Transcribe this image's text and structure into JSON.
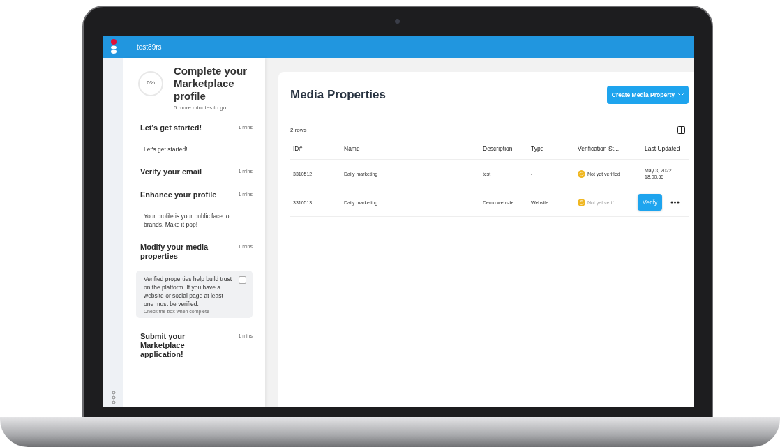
{
  "top_bar": {
    "title": "test89rs"
  },
  "onboarding": {
    "progress": {
      "label": "0%",
      "level": 0
    },
    "title": "Complete your Marketplace profile",
    "subtitle": "5 more minutes to go!",
    "steps": [
      {
        "kind": "text",
        "title": "Let's get started!",
        "duration": "1 mins",
        "description": "Let's get started!"
      },
      {
        "kind": "none",
        "title": "Verify your email",
        "duration": "1 mins"
      },
      {
        "kind": "text",
        "title": "Enhance your profile",
        "duration": "1 mins",
        "description": "Your profile is your public face to brands. Make it pop!"
      },
      {
        "kind": "checkbox",
        "title": "Modify your media properties",
        "duration": "1 mins",
        "description": "Verified properties help build trust on the platform. If you have a website or social page at least one must be verified.",
        "hint": "Check the box when complete",
        "checked": false
      },
      {
        "kind": "none",
        "title": "Submit your Marketplace application!",
        "duration": "1 mins"
      }
    ]
  },
  "main": {
    "title": "Media Properties",
    "create_button": "Create Media Property",
    "row_count": "2 rows",
    "table": {
      "columns": [
        "ID#",
        "Name",
        "Description",
        "Type",
        "Verification St...",
        "Last Updated"
      ],
      "rows": [
        {
          "id": "3310512",
          "name": "Daily marketing",
          "description": "test",
          "type": "-",
          "status": "Not yet verified",
          "last_updated": "May 3, 2022 18:00:55",
          "hovered": false
        },
        {
          "id": "3310513",
          "name": "Daily marketing",
          "description": "Demo website",
          "type": "Website",
          "status": "Not yet verif",
          "verify_button": "Verify",
          "hovered": true
        }
      ]
    }
  }
}
